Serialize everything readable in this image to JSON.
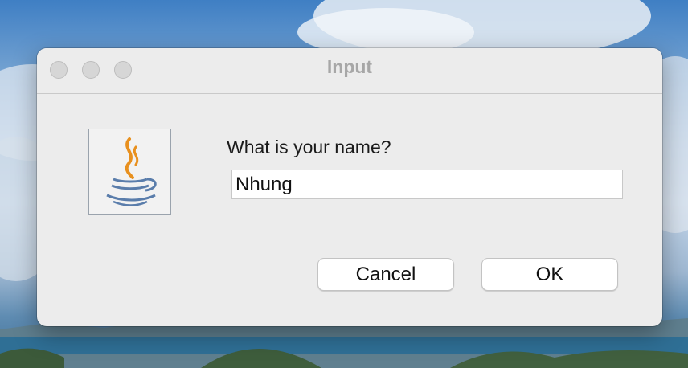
{
  "dialog": {
    "title": "Input",
    "prompt": "What is your name?",
    "name_value": "Nhung",
    "icon": "java-coffee-cup-icon",
    "cancel_label": "Cancel",
    "ok_label": "OK"
  },
  "window_controls": [
    "close",
    "minimize",
    "zoom"
  ],
  "colors": {
    "dialog_bg": "#ececec",
    "title_text": "#a7a7a7",
    "button_bg": "#ffffff",
    "java_steam": "#e8901e",
    "java_cup": "#5a7dab"
  }
}
